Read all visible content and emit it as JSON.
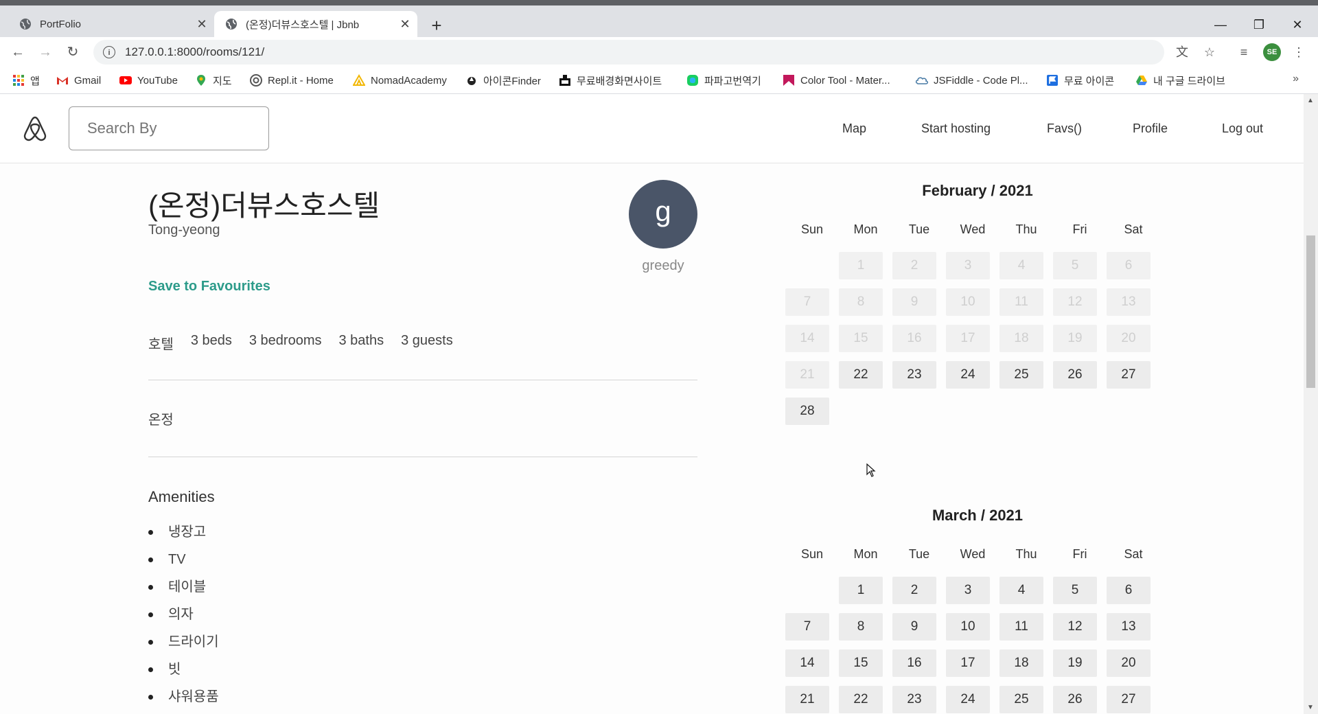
{
  "browser": {
    "tabs": [
      {
        "title": "PortFolio",
        "active": false
      },
      {
        "title": "(온정)더뷰스호스텔 | Jbnb",
        "active": true
      }
    ],
    "url": "127.0.0.1:8000/rooms/121/",
    "profile_initials": "SE",
    "bookmarks": [
      {
        "label": "앱",
        "icon": "apps-grid-icon"
      },
      {
        "label": "Gmail",
        "icon": "gmail-icon"
      },
      {
        "label": "YouTube",
        "icon": "youtube-icon"
      },
      {
        "label": "지도",
        "icon": "maps-pin-icon"
      },
      {
        "label": "Repl.it - Home",
        "icon": "replit-icon"
      },
      {
        "label": "NomadAcademy",
        "icon": "nomad-icon"
      },
      {
        "label": "아이콘Finder",
        "icon": "iconfinder-icon"
      },
      {
        "label": "무료배경화면사이트",
        "icon": "wallpaper-icon"
      },
      {
        "label": "파파고번역기",
        "icon": "papago-icon"
      },
      {
        "label": "Color Tool - Mater...",
        "icon": "colortool-icon"
      },
      {
        "label": "JSFiddle - Code Pl...",
        "icon": "jsfiddle-icon"
      },
      {
        "label": "무료 아이콘",
        "icon": "flag-icon"
      },
      {
        "label": "내 구글 드라이브",
        "icon": "drive-icon"
      }
    ],
    "bookmarks_more": "»"
  },
  "header": {
    "search_placeholder": "Search By",
    "nav": [
      "Map",
      "Start hosting",
      "Favs()",
      "Profile",
      "Log out"
    ]
  },
  "room": {
    "name": "(온정)더뷰스호스텔",
    "city": "Tong-yeong",
    "host_initial": "g",
    "host_name": "greedy",
    "save_label": "Save to Favourites",
    "specs": [
      "호텔",
      "3 beds",
      "3 bedrooms",
      "3 baths",
      "3 guests"
    ],
    "description": "온정",
    "amenities_title": "Amenities",
    "amenities": [
      "냉장고",
      "TV",
      "테이블",
      "의자",
      "드라이기",
      "빗",
      "샤워용품"
    ]
  },
  "calendars": [
    {
      "title": "February / 2021",
      "weekdays": [
        "Sun",
        "Mon",
        "Tue",
        "Wed",
        "Thu",
        "Fri",
        "Sat"
      ],
      "first_weekday": 1,
      "days": 28,
      "past_until": 21,
      "visible_days": 28
    },
    {
      "title": "March / 2021",
      "weekdays": [
        "Sun",
        "Mon",
        "Tue",
        "Wed",
        "Thu",
        "Fri",
        "Sat"
      ],
      "first_weekday": 1,
      "days": 31,
      "past_until": 0,
      "visible_days": 27
    }
  ]
}
